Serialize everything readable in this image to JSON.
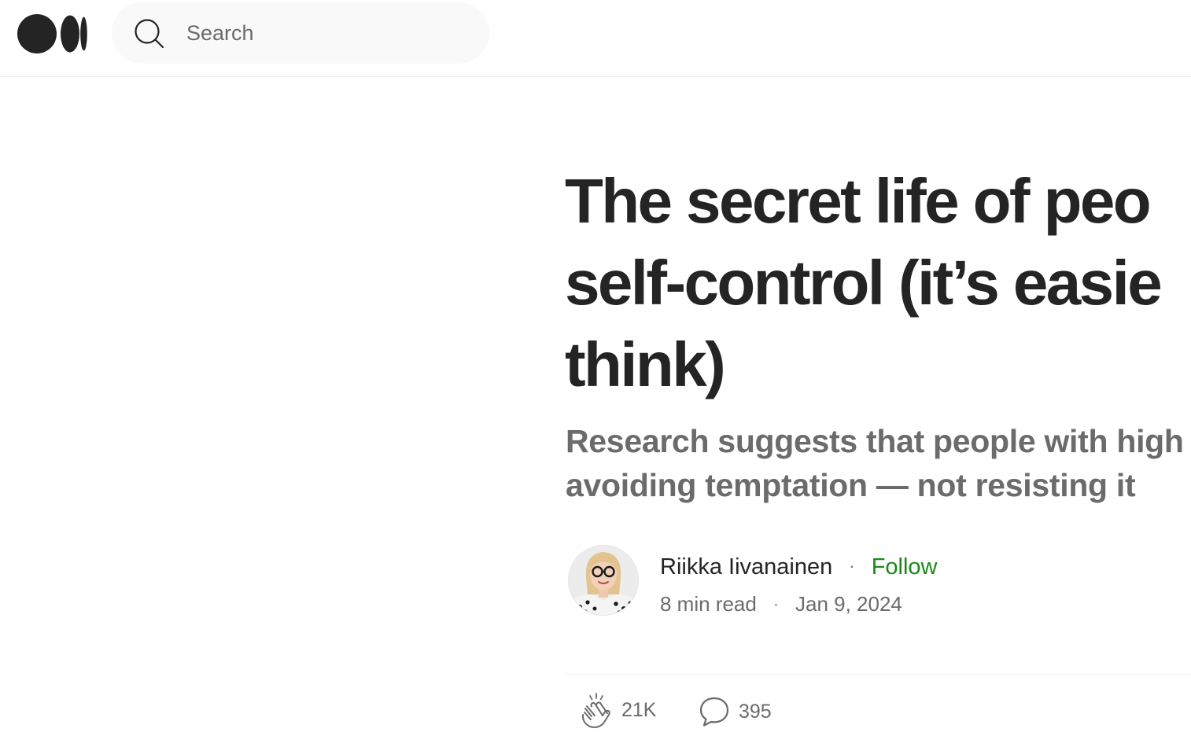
{
  "header": {
    "logo_icon": "medium-logo-icon",
    "search": {
      "icon": "search-icon",
      "placeholder": "Search",
      "value": ""
    }
  },
  "article": {
    "title_lines": [
      "The secret life of peo",
      "self-control (it’s easie",
      "think)"
    ],
    "subtitle_lines": [
      "Research suggests that people with high",
      "avoiding temptation — not resisting it"
    ],
    "author": {
      "name": "Riikka Iivanainen",
      "follow_label": "Follow",
      "separator": "·",
      "avatar_icon": "author-avatar"
    },
    "meta": {
      "read_time": "8 min read",
      "separator": "·",
      "date": "Jan 9, 2024"
    },
    "actions": {
      "claps": "21K",
      "comments": "395",
      "clap_icon": "clap-icon",
      "comment_icon": "comment-icon"
    }
  },
  "colors": {
    "text": "#242424",
    "muted": "#6b6b6b",
    "follow": "#1a8917",
    "search_bg": "#f9f9f9",
    "divider": "#f0f0f0"
  }
}
